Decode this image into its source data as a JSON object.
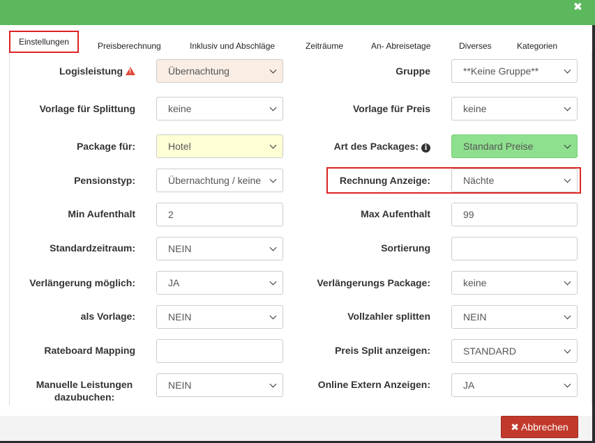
{
  "header": {
    "close_symbol": "✖"
  },
  "tabs": [
    {
      "label": "Einstellungen"
    },
    {
      "label": "Preisberechnung"
    },
    {
      "label": "Inklusiv und Abschläge"
    },
    {
      "label": "Zeiträume"
    },
    {
      "label": "An- Abreisetage"
    },
    {
      "label": "Diverses"
    },
    {
      "label": "Kategorien"
    }
  ],
  "form": {
    "left": [
      {
        "label": "Logisleistung",
        "value": "Übernachtung",
        "type": "select"
      },
      {
        "label": "Vorlage für Splittung",
        "value": "keine",
        "type": "select"
      },
      {
        "label": "Package für:",
        "value": "Hotel",
        "type": "select"
      },
      {
        "label": "Pensionstyp:",
        "value": "Übernachtung / keine",
        "type": "select"
      },
      {
        "label": "Min Aufenthalt",
        "value": "2",
        "type": "input"
      },
      {
        "label": "Standardzeitraum:",
        "value": "NEIN",
        "type": "select"
      },
      {
        "label": "Verlängerung möglich:",
        "value": "JA",
        "type": "select"
      },
      {
        "label": "als Vorlage:",
        "value": "NEIN",
        "type": "select"
      },
      {
        "label": "Rateboard Mapping",
        "value": "",
        "type": "input"
      },
      {
        "label": "Manuelle Leistungen dazubuchen:",
        "value": "NEIN",
        "type": "select"
      }
    ],
    "right": [
      {
        "label": "Gruppe",
        "value": "**Keine Gruppe**",
        "type": "select"
      },
      {
        "label": "Vorlage für Preis",
        "value": "keine",
        "type": "select"
      },
      {
        "label": "Art des Packages:",
        "value": "Standard Preise",
        "type": "select"
      },
      {
        "label": "Rechnung Anzeige:",
        "value": "Nächte",
        "type": "select"
      },
      {
        "label": "Max Aufenthalt",
        "value": "99",
        "type": "input"
      },
      {
        "label": "Sortierung",
        "value": "",
        "type": "input"
      },
      {
        "label": "Verlängerungs Package:",
        "value": "keine",
        "type": "select"
      },
      {
        "label": "Vollzahler splitten",
        "value": "NEIN",
        "type": "select"
      },
      {
        "label": "Preis Split anzeigen:",
        "value": "STANDARD",
        "type": "select"
      },
      {
        "label": "Online Extern Anzeigen:",
        "value": "JA",
        "type": "select"
      }
    ]
  },
  "colors": {
    "header_green": "#5cb85c",
    "highlight_red": "#dd2222",
    "logisleistung_bg": "#f9ede4",
    "package_fuer_bg": "#ffffd6",
    "art_des_packages_bg": "#8ee08e",
    "cancel_button_bg": "#c0392b"
  },
  "footer": {
    "cancel_label": "Abbrechen",
    "cancel_icon": "✖"
  }
}
